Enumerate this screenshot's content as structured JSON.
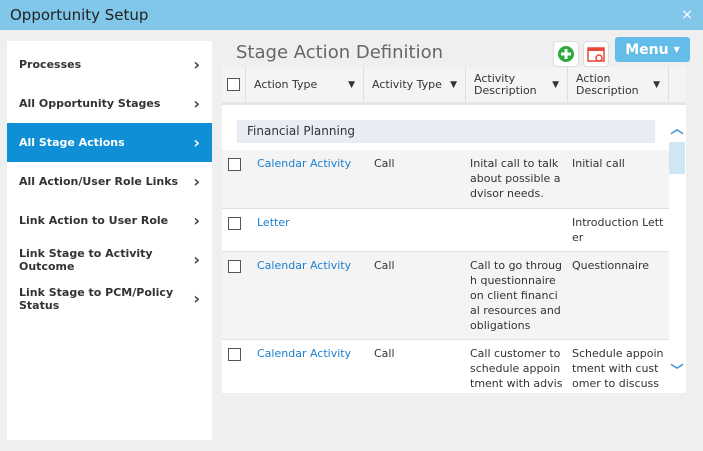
{
  "window": {
    "title": "Opportunity Setup",
    "close": "×"
  },
  "sidebar": {
    "items": [
      {
        "label": "Processes"
      },
      {
        "label": "All Opportunity Stages"
      },
      {
        "label": "All Stage Actions",
        "active": true
      },
      {
        "label": "All Action/User Role Links"
      },
      {
        "label": "Link Action to User Role"
      },
      {
        "label": "Link Stage to Activity Outcome"
      },
      {
        "label": "Link Stage to PCM/Policy Status"
      }
    ]
  },
  "page": {
    "title": "Stage Action Definition",
    "menu_label": "Menu",
    "icons": [
      "add-circle-icon",
      "calendar-settings-icon"
    ]
  },
  "table": {
    "columns": [
      "Action Type",
      "Activity Type",
      "Activity Description",
      "Action Description"
    ],
    "group": "Financial Planning",
    "rows": [
      {
        "action_type": "Calendar Activity",
        "activity_type": "Call",
        "activity_desc": "Inital call to talk about possible advisor needs.",
        "action_desc": "Initial call"
      },
      {
        "action_type": "Letter",
        "activity_type": "",
        "activity_desc": "",
        "action_desc": "Introduction Letter"
      },
      {
        "action_type": "Calendar Activity",
        "activity_type": "Call",
        "activity_desc": "Call to go through questionnaire on client financial resources and obligations",
        "action_desc": "Questionnaire"
      },
      {
        "action_type": "Calendar Activity",
        "activity_type": "Call",
        "activity_desc": "Call customer to schedule appointment with advisor.",
        "action_desc": "Schedule appointment with customer to discuss finan"
      }
    ]
  },
  "colors": {
    "titlebar": "#80c7ea",
    "active": "#0e8fd6",
    "link": "#1a7fd0",
    "menu": "#63bde8"
  }
}
